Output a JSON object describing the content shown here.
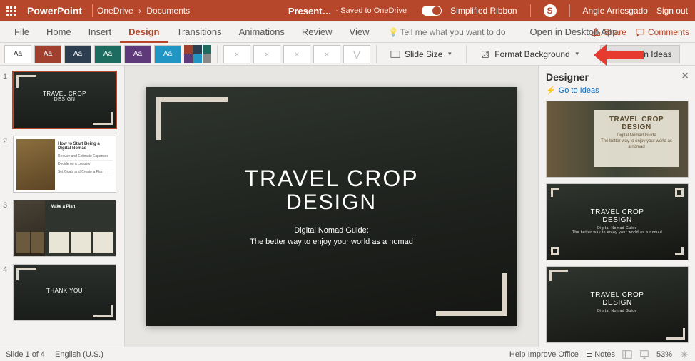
{
  "title": {
    "app": "PowerPoint",
    "loc1": "OneDrive",
    "loc2": "Documents",
    "file": "Present…",
    "saved": "-  Saved to OneDrive",
    "simplified": "Simplified Ribbon",
    "user": "Angie Arriesgado",
    "signout": "Sign out"
  },
  "tabs": {
    "file": "File",
    "home": "Home",
    "insert": "Insert",
    "design": "Design",
    "transitions": "Transitions",
    "animations": "Animations",
    "review": "Review",
    "view": "View",
    "tell": "Tell me what you want to do",
    "open": "Open in Desktop App",
    "share": "Share",
    "comments": "Comments"
  },
  "ribbon": {
    "slidesize": "Slide Size",
    "formatbg": "Format Background",
    "designideas": "Design Ideas"
  },
  "slide": {
    "h1": "TRAVEL CROP",
    "h2": "DESIGN",
    "sub1": "Digital Nomad Guide:",
    "sub2": "The better way to enjoy your world as a nomad"
  },
  "thumbs": [
    {
      "n": "1",
      "title": "TRAVEL CROP",
      "sub": "DESIGN"
    },
    {
      "n": "2",
      "title": "How to Start Being a Digital Nomad",
      "i1": "Reduce and Estimate Expenses",
      "i2": "Decide on a Location",
      "i3": "Set Goals and Create a Plan"
    },
    {
      "n": "3",
      "title": "Make a Plan"
    },
    {
      "n": "4",
      "title": "THANK YOU"
    }
  ],
  "designer": {
    "title": "Designer",
    "goto": "Go to Ideas",
    "ideaTitle": "TRAVEL CROP",
    "ideaSub": "DESIGN",
    "ideaSmall1": "Digital Nomad Guide",
    "ideaSmall2": "The better way to enjoy your world as a nomad"
  },
  "status": {
    "slide": "Slide 1 of 4",
    "lang": "English (U.S.)",
    "improve": "Help Improve Office",
    "notes": "Notes",
    "zoom": "53%"
  }
}
